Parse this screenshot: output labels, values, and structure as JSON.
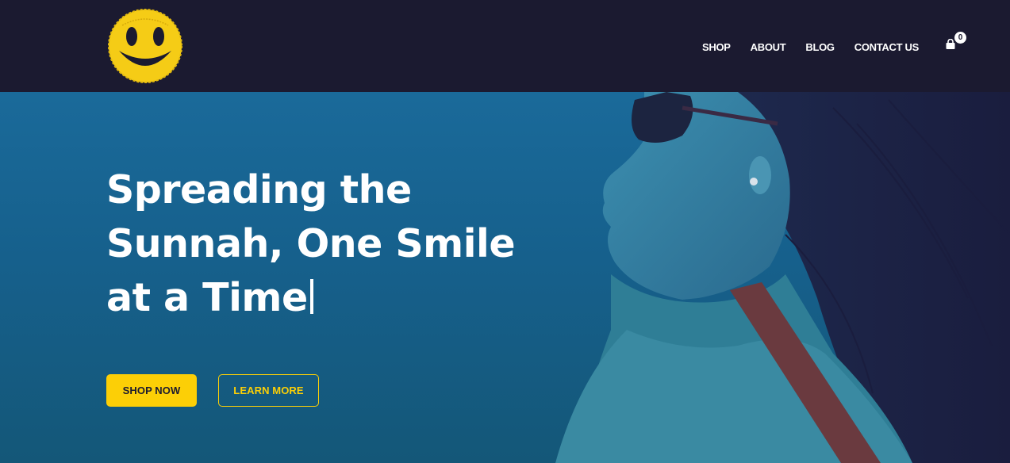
{
  "header": {
    "logo_icon": "smiley-face-logo",
    "nav": [
      {
        "label": "SHOP"
      },
      {
        "label": "ABOUT"
      },
      {
        "label": "BLOG"
      },
      {
        "label": "CONTACT US"
      }
    ],
    "cart_icon": "shopping-bag-icon",
    "cart_count": "0"
  },
  "hero": {
    "headline": "Spreading the Sunnah, One Smile at a Time",
    "primary_button": "SHOP NOW",
    "secondary_button": "LEARN MORE",
    "image": "woman-with-sunglasses-photo"
  },
  "colors": {
    "header_bg": "#1b1a30",
    "hero_bg": "#16608c",
    "accent": "#fccf06"
  }
}
